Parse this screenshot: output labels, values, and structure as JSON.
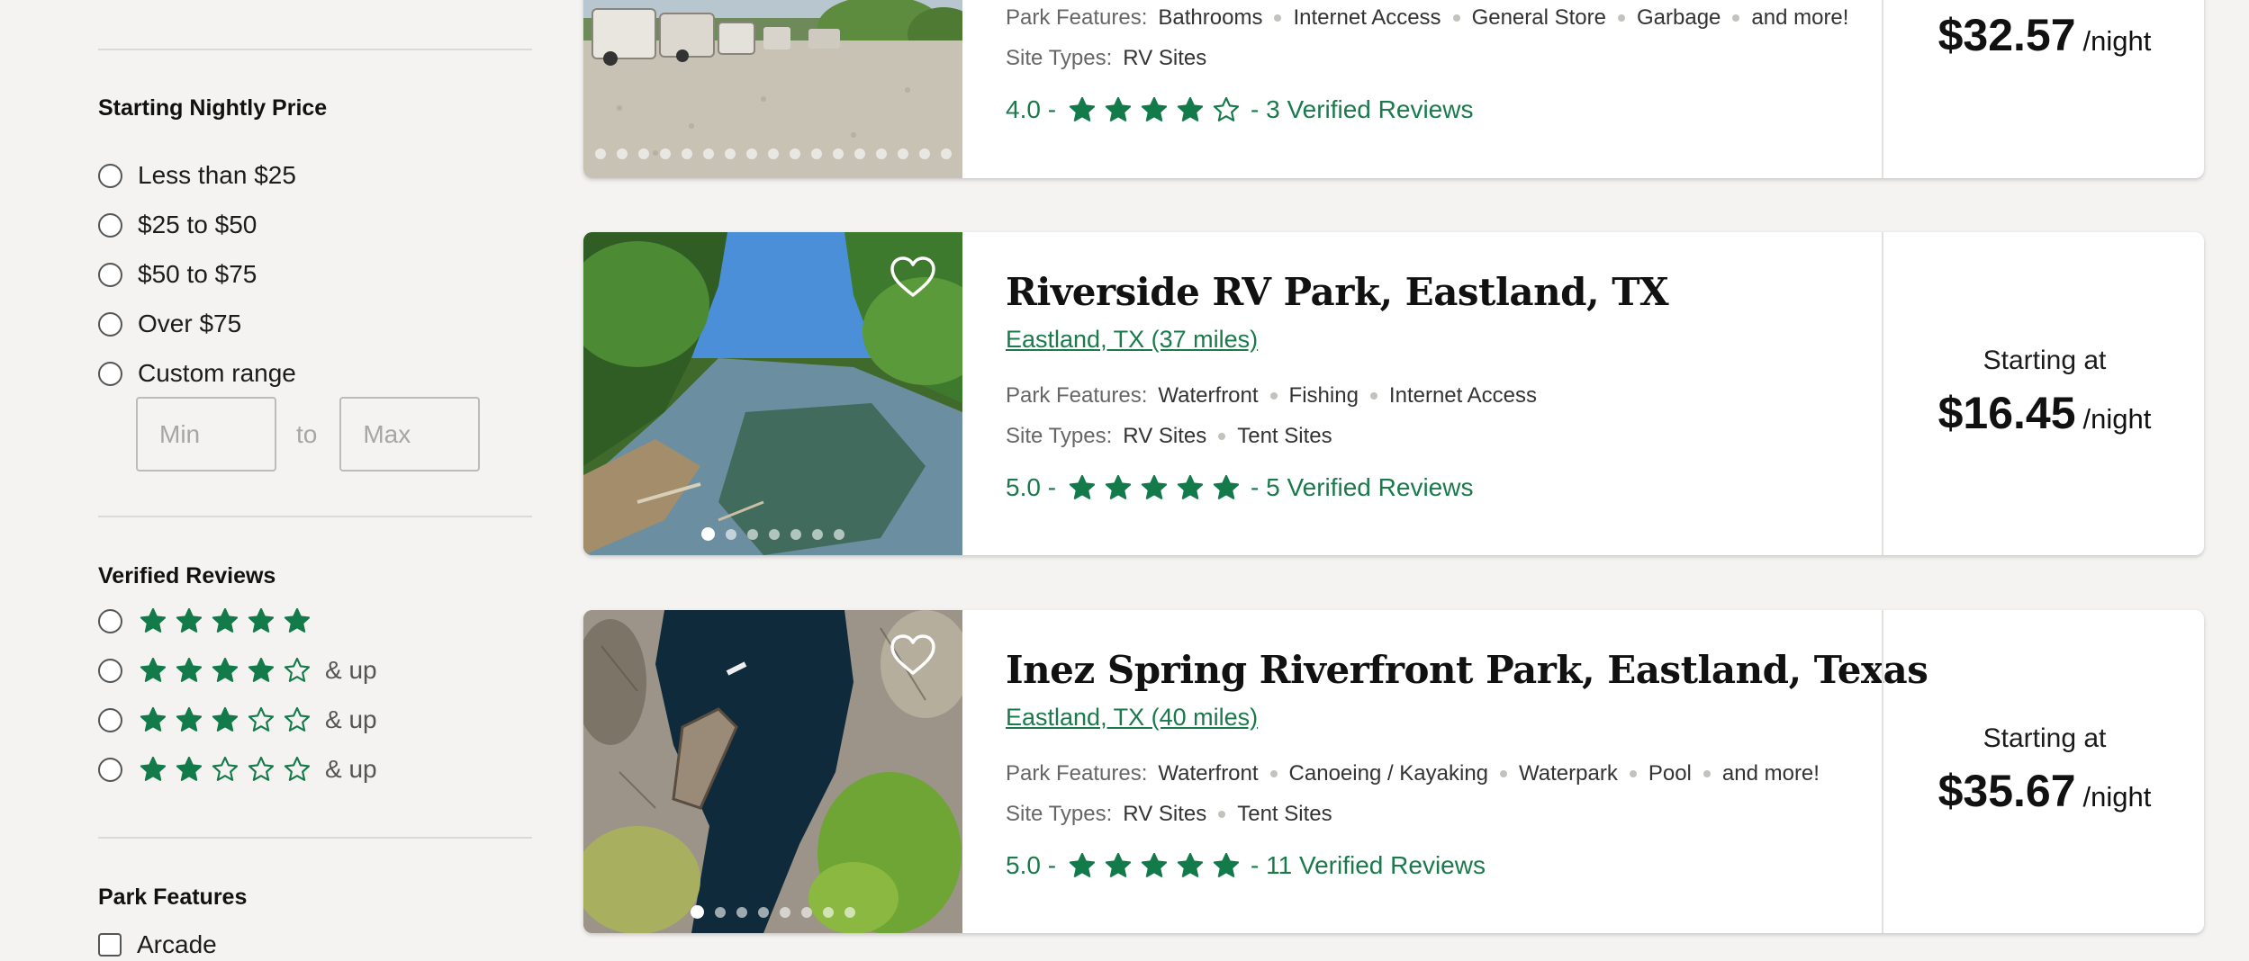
{
  "filters": {
    "price": {
      "title": "Starting Nightly Price",
      "options": [
        "Less than $25",
        "$25 to $50",
        "$50 to $75",
        "Over $75",
        "Custom range"
      ],
      "min_placeholder": "Min",
      "to_label": "to",
      "max_placeholder": "Max"
    },
    "reviews": {
      "title": "Verified Reviews",
      "options": [
        {
          "stars": 5,
          "suffix": ""
        },
        {
          "stars": 4,
          "suffix": "& up"
        },
        {
          "stars": 3,
          "suffix": "& up"
        },
        {
          "stars": 2,
          "suffix": "& up"
        }
      ]
    },
    "features": {
      "title": "Park Features",
      "options": [
        "Arcade"
      ]
    }
  },
  "listings": [
    {
      "title": "",
      "location": "",
      "features_label": "Park Features:",
      "features": [
        "Bathrooms",
        "Internet Access",
        "General Store",
        "Garbage",
        "and more!"
      ],
      "site_types_label": "Site Types:",
      "site_types": [
        "RV Sites"
      ],
      "rating": "4.0",
      "stars": 4,
      "reviews": "3 Verified Reviews",
      "starting_label": "",
      "price": "$32.57",
      "unit": "/night",
      "photo_dots": 17,
      "active_dot": -1,
      "favorite_icon": "heart-outline-icon"
    },
    {
      "title": "Riverside RV Park, Eastland, TX",
      "location": "Eastland, TX (37 miles)",
      "features_label": "Park Features:",
      "features": [
        "Waterfront",
        "Fishing",
        "Internet Access"
      ],
      "site_types_label": "Site Types:",
      "site_types": [
        "RV Sites",
        "Tent Sites"
      ],
      "rating": "5.0",
      "stars": 5,
      "reviews": "5 Verified Reviews",
      "starting_label": "Starting at",
      "price": "$16.45",
      "unit": "/night",
      "photo_dots": 7,
      "active_dot": 0,
      "favorite_icon": "heart-outline-icon"
    },
    {
      "title": "Inez Spring Riverfront Park, Eastland, Texas",
      "location": "Eastland, TX (40 miles)",
      "features_label": "Park Features:",
      "features": [
        "Waterfront",
        "Canoeing / Kayaking",
        "Waterpark",
        "Pool",
        "and more!"
      ],
      "site_types_label": "Site Types:",
      "site_types": [
        "RV Sites",
        "Tent Sites"
      ],
      "rating": "5.0",
      "stars": 5,
      "reviews": "11 Verified Reviews",
      "starting_label": "Starting at",
      "price": "$35.67",
      "unit": "/night",
      "photo_dots": 8,
      "active_dot": 0,
      "favorite_icon": "heart-outline-icon"
    }
  ],
  "colors": {
    "accent_green": "#1a7a4c",
    "star_green": "#137a4a",
    "background": "#f4f3f1"
  }
}
